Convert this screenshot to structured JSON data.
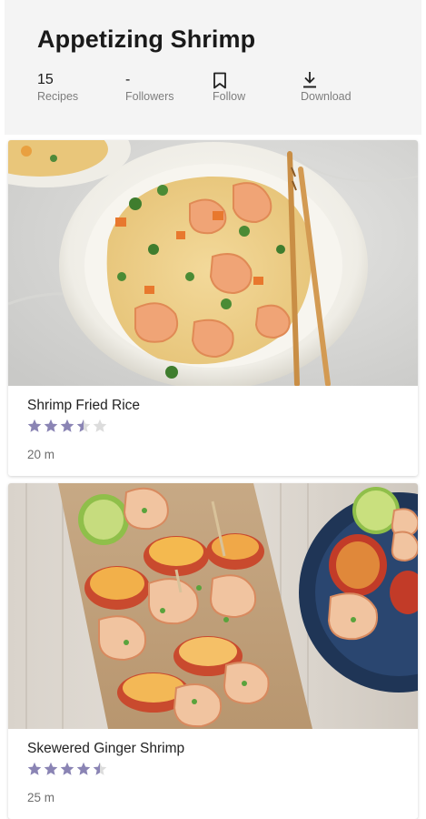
{
  "header": {
    "title": "Appetizing Shrimp",
    "stats": [
      {
        "value": "15",
        "label": "Recipes"
      },
      {
        "value": "-",
        "label": "Followers"
      },
      {
        "icon": "bookmark-icon",
        "label": "Follow"
      },
      {
        "icon": "download-icon",
        "label": "Download"
      }
    ]
  },
  "recipes": [
    {
      "name": "Shrimp Fried Rice",
      "rating": 3.5,
      "rating_max": 5,
      "time": "20 m"
    },
    {
      "name": "Skewered Ginger Shrimp",
      "rating": 4.5,
      "rating_max": 5,
      "time": "25 m"
    }
  ],
  "colors": {
    "star_filled": "#8a84b4",
    "star_empty": "#dcdcdc",
    "header_bg": "#f4f4f4"
  }
}
